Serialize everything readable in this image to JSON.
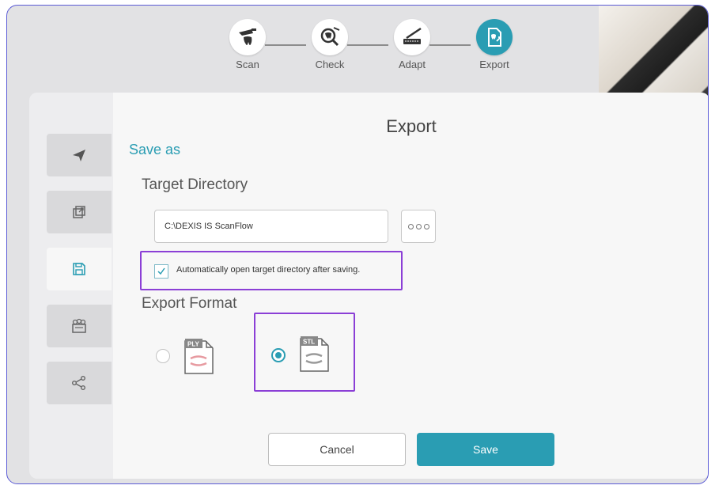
{
  "steps": [
    {
      "label": "Scan",
      "icon": "scanner-tooth-icon"
    },
    {
      "label": "Check",
      "icon": "magnify-tooth-icon"
    },
    {
      "label": "Adapt",
      "icon": "knife-jaw-icon"
    },
    {
      "label": "Export",
      "icon": "export-file-icon",
      "active": true
    }
  ],
  "sidebar": {
    "items": [
      {
        "icon": "send-icon"
      },
      {
        "icon": "external-link-icon"
      },
      {
        "icon": "save-icon",
        "active": true
      },
      {
        "icon": "dental-lab-icon"
      },
      {
        "icon": "share-icon"
      }
    ]
  },
  "dialog": {
    "title": "Export",
    "save_as": "Save as",
    "target_directory_label": "Target Directory",
    "path_value": "C:\\DEXIS IS ScanFlow",
    "auto_open_label": "Automatically open target directory after saving.",
    "auto_open_checked": true,
    "export_format_label": "Export Format",
    "formats": [
      {
        "badge": "PLY",
        "selected": false
      },
      {
        "badge": "STL",
        "selected": true
      }
    ],
    "cancel_label": "Cancel",
    "save_label": "Save"
  },
  "colors": {
    "accent": "#2a9db3",
    "highlight": "#8b3fd6",
    "ply_lip": "#e79aa0",
    "stl_lip": "#9a9a9a"
  }
}
